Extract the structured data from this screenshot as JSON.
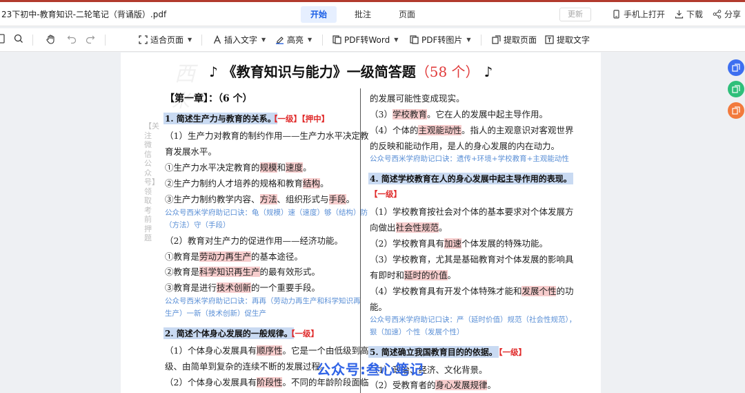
{
  "app": {
    "doc_title": "23下初中-教育知识-二轮笔记（背诵版）.pdf",
    "tabs": [
      "开始",
      "批注",
      "页面"
    ],
    "update_label": "更新",
    "open_phone": "手机上打开",
    "download": "下载",
    "share": "分享"
  },
  "toolbar": {
    "fit_page": "适合页面",
    "insert_text": "插入文字",
    "highlight": "高亮",
    "pdf_word": "PDF转Word",
    "pdf_image": "PDF转图片",
    "extract_page": "提取页面",
    "extract_text": "提取文字"
  },
  "doc": {
    "heading_prefix": "♪ 《教育知识与能力》一级简答题",
    "heading_count": "（58 个）",
    "heading_suffix": "♪",
    "vertical_note": "【关注微信公众号】领取考前押题",
    "chapter": "【第一章】：（6 个）",
    "stamp": "公众号:叁心笔记",
    "left": {
      "q1_title": "1. 简述生产力与教育的关系。",
      "q1_tag": "【一级】【押中】",
      "l1": "（1）生产力对教育的制约作用——生产力水平决定教",
      "l2": "育发展水平。",
      "l3a": "①生产力水平决定教育的",
      "l3b": "规模",
      "l3c": "和",
      "l3d": "速度",
      "l3e": "。",
      "l4a": "②生产力制约人才培养的规格和教育",
      "l4b": "结构",
      "l4c": "。",
      "l5a": "③生产力制约教学内容、",
      "l5b": "方法",
      "l5c": "、组织形式与",
      "l5d": "手段",
      "l5e": "。",
      "n1": "公众号西米学府助记口诀：龟（规模）速（速度）够（结构）防",
      "n2": "（方法）守（手段）",
      "l6": "（2）教育对生产力的促进作用——经济功能。",
      "l7a": "①教育是",
      "l7b": "劳动力再生产",
      "l7c": "的基本途径。",
      "l8a": "②教育是",
      "l8b": "科学知识再生产",
      "l8c": "的最有效形式。",
      "l9a": "③教育是进行",
      "l9b": "技术创新",
      "l9c": "的一个重要手段。",
      "n3": "公众号西米学府助记口诀：再再（劳动力再生产和科学知识再",
      "n4": "生产）一新（技术创新）促生产",
      "q2_title": "2. 简述个体身心发展的一般规律。",
      "q2_tag": "【一级】",
      "l10a": "（1）个体身心发展具有",
      "l10b": "顺序性",
      "l10c": "。它是一个由低级到高",
      "l11": "级、由简单到复杂的连续不断的发展过程。",
      "l12a": "（2）个体身心发展具有",
      "l12b": "阶段性",
      "l12c": "。不同的年龄阶段面临"
    },
    "right": {
      "r1": "的发展可能性变成现实。",
      "r2a": "（3）",
      "r2b": "学校教育",
      "r2c": "。它在人的发展中起主导作用。",
      "r3a": "（4）个体的",
      "r3b": "主观能动性",
      "r3c": "。指人的主观意识对客观世界",
      "r4": "的反映和能动作用，是人的身心发展的内在动力。",
      "n5": "公众号西米学府助记口诀：遗传+环境+学校教育+主观能动性",
      "q4_title": "4. 简述学校教育在人的身心发展中起主导作用的表现。",
      "q4_tag": "【一级】",
      "r5": "（1）学校教育按社会对个体的基本要求对个体发展方",
      "r6a": "向做出",
      "r6b": "社会性规范",
      "r6c": "。",
      "r7a": "（2）学校教育具有",
      "r7b": "加速",
      "r7c": "个体发展的特殊功能。",
      "r8": "（3）学校教育，尤其是基础教育对个体发展的影响具",
      "r9a": "有即时和",
      "r9b": "延时的价值",
      "r9c": "。",
      "r10a": "（4）学校教育具有开发个体特殊才能和",
      "r10b": "发展个性",
      "r10c": "的功",
      "r11": "能。",
      "n6": "公众号西米学府助记口诀：严（延时价值）规范（社会性规范），",
      "n7": "狠（加速）个性（发展个性）",
      "q5_title": "5. 简述确立我国教育目的的依据。",
      "q5_tag": "【一级】",
      "r12": "（1）政治、经济、文化背景。",
      "r13a": "（2）受教育者的",
      "r13b": "身心发展规律",
      "r13c": "。"
    }
  },
  "colors": {
    "accent": "#1a5ee6",
    "highlight": "#f6cccc",
    "title_bg": "#c9daf2",
    "tag_red": "#e02b2b",
    "note_blue": "#5a8fd6"
  }
}
